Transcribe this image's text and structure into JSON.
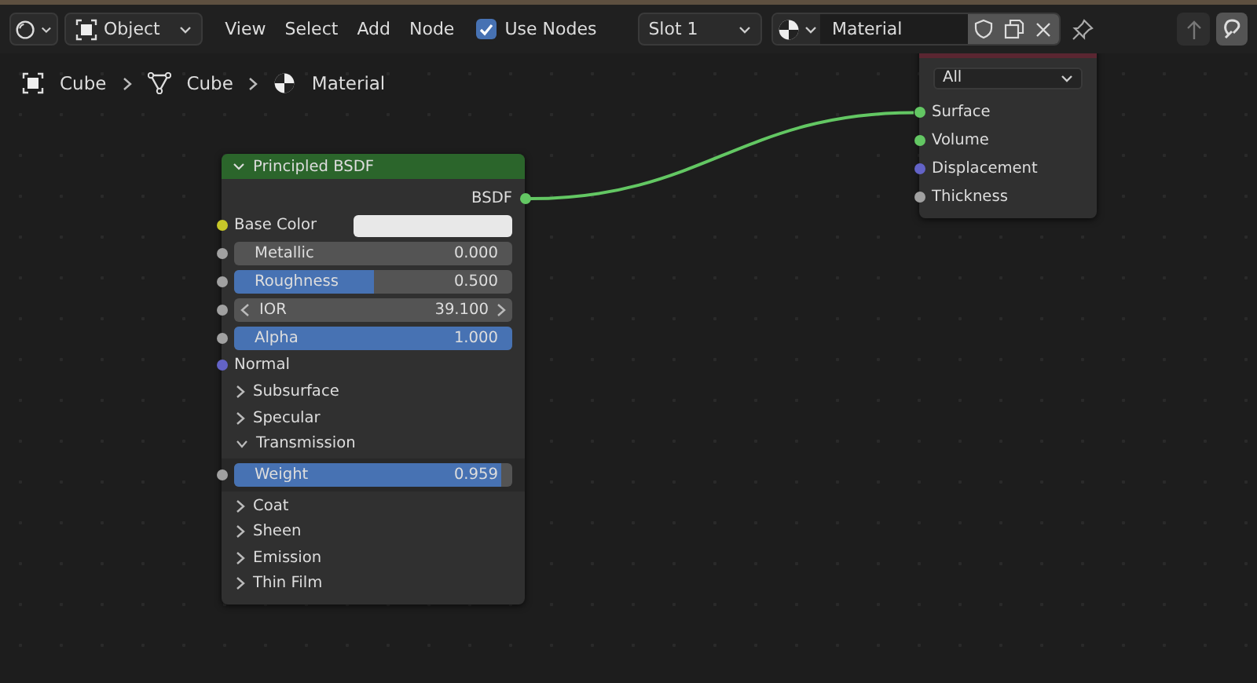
{
  "header": {
    "mode": "Object",
    "menus": [
      "View",
      "Select",
      "Add",
      "Node"
    ],
    "use_nodes": {
      "label": "Use Nodes",
      "checked": true
    },
    "slot": "Slot 1",
    "material": "Material"
  },
  "breadcrumbs": [
    {
      "kind": "object",
      "label": "Cube"
    },
    {
      "kind": "mesh",
      "label": "Cube"
    },
    {
      "kind": "material",
      "label": "Material"
    }
  ],
  "nodes": [
    {
      "title": "Principled BSDF",
      "color": "#2b652b",
      "expanded": true,
      "rows": [
        {
          "kind": "output",
          "label": "BSDF",
          "color": "#63c763",
          "linked": true
        },
        {
          "kind": "color",
          "label": "Base Color",
          "color": "#c7c729",
          "swatch": {
            "color": "#e8e8e8"
          }
        },
        {
          "kind": "slider",
          "label": "Metallic",
          "value": "0.000",
          "level": 0,
          "color": "#a1a1a1"
        },
        {
          "kind": "slider",
          "label": "Roughness",
          "value": "0.500",
          "level": 0.5,
          "color": "#a1a1a1"
        },
        {
          "kind": "number",
          "label": "IOR",
          "value": "39.100",
          "color": "#a1a1a1"
        },
        {
          "kind": "slider",
          "label": "Alpha",
          "value": "1.000",
          "level": 1,
          "color": "#a1a1a1"
        },
        {
          "kind": "input",
          "label": "Normal",
          "color": "#6363c7"
        },
        {
          "kind": "panel",
          "label": "Subsurface",
          "expanded": false
        },
        {
          "kind": "panel",
          "label": "Specular",
          "expanded": false
        },
        {
          "kind": "panel",
          "label": "Transmission",
          "expanded": true,
          "children": [
            {
              "kind": "slider",
              "label": "Weight",
              "value": "0.959",
              "level": 0.959,
              "color": "#a1a1a1"
            }
          ]
        },
        {
          "kind": "panel",
          "label": "Coat",
          "expanded": false
        },
        {
          "kind": "panel",
          "label": "Sheen",
          "expanded": false
        },
        {
          "kind": "panel",
          "label": "Emission",
          "expanded": false
        },
        {
          "kind": "panel",
          "label": "Thin Film",
          "expanded": false
        }
      ]
    },
    {
      "color": "#5a2631",
      "rows": [
        {
          "kind": "dropdown",
          "value": "All"
        },
        {
          "kind": "input",
          "label": "Surface",
          "color": "#63c763",
          "linked": true
        },
        {
          "kind": "input",
          "label": "Volume",
          "color": "#63c763"
        },
        {
          "kind": "input",
          "label": "Displacement",
          "color": "#6363c7"
        },
        {
          "kind": "input",
          "label": "Thickness",
          "color": "#a1a1a1"
        }
      ]
    }
  ]
}
